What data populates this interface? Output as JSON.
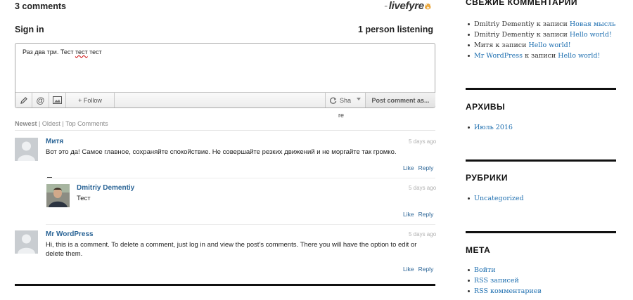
{
  "comments_area": {
    "count_label": "3 comments",
    "brand": "livefyre",
    "sign_in": "Sign in",
    "listening": "1 person listening",
    "editor": {
      "text_before": "Раз два три. Тест ",
      "text_misspelled": "тест",
      "text_after": " тест"
    },
    "toolbar": {
      "follow_label": "+ Follow",
      "share_label": "Sha",
      "post_label": "Post comment as..."
    },
    "overflow_text": "re",
    "sort": {
      "newest": "Newest",
      "oldest": "Oldest",
      "top": "Top Comments",
      "separator": "|"
    },
    "comments": [
      {
        "author": "Митя",
        "time": "5 days ago",
        "text": "Вот это да! Самое главное, сохраняйте спокойствие. Не совершайте резких движений и не моргайте так громко.",
        "like": "Like",
        "reply": "Reply"
      },
      {
        "author": "Dmitriy Dementiy",
        "time": "5 days ago",
        "text": "Тест",
        "like": "Like",
        "reply": "Reply"
      },
      {
        "author": "Mr WordPress",
        "time": "5 days ago",
        "text": "Hi, this is a comment. To delete a comment, just log in and view the post's comments. There you will have the option to edit or delete them.",
        "like": "Like",
        "reply": "Reply"
      }
    ],
    "colors": {
      "link": "#2a6496",
      "muted": "#b0b0b0",
      "brand_flame": "#e89b21"
    }
  },
  "sidebar": {
    "recent_comments": {
      "title": "СВЕЖИЕ КОММЕНТАРИИ",
      "items": [
        {
          "author": "Dmitriy Dementiy",
          "connector": " к записи ",
          "post": "Новая мысль"
        },
        {
          "author": "Dmitriy Dementiy",
          "connector": " к записи ",
          "post": "Hello world!"
        },
        {
          "author": "Митя",
          "connector": " к записи ",
          "post": "Hello world!"
        },
        {
          "author": "Mr WordPress",
          "connector": " к записи ",
          "post": "Hello world!"
        }
      ]
    },
    "archives": {
      "title": "АРХИВЫ",
      "items": [
        "Июль 2016"
      ]
    },
    "categories": {
      "title": "РУБРИКИ",
      "items": [
        "Uncategorized"
      ]
    },
    "meta": {
      "title": "МЕТА",
      "items": [
        "Войти",
        "RSS записей",
        "RSS комментариев"
      ]
    },
    "link_color": "#1e6fb0"
  }
}
